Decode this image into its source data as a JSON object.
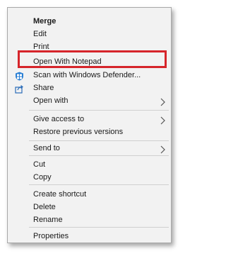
{
  "context_menu": {
    "items": [
      {
        "label": "Merge",
        "bold": true
      },
      {
        "label": "Edit"
      },
      {
        "label": "Print"
      },
      {
        "label": "Open With Notepad",
        "highlighted": true
      },
      {
        "label": "Scan with Windows Defender...",
        "icon": "windows-defender-icon"
      },
      {
        "label": "Share",
        "icon": "share-icon"
      },
      {
        "label": "Open with",
        "submenu": true
      },
      {
        "label": "Give access to",
        "submenu": true
      },
      {
        "label": "Restore previous versions"
      },
      {
        "label": "Send to",
        "submenu": true
      },
      {
        "label": "Cut"
      },
      {
        "label": "Copy"
      },
      {
        "label": "Create shortcut"
      },
      {
        "label": "Delete"
      },
      {
        "label": "Rename"
      },
      {
        "label": "Properties"
      }
    ]
  },
  "colors": {
    "menu_background": "#f2f2f2",
    "highlight_border": "#d6252b"
  }
}
